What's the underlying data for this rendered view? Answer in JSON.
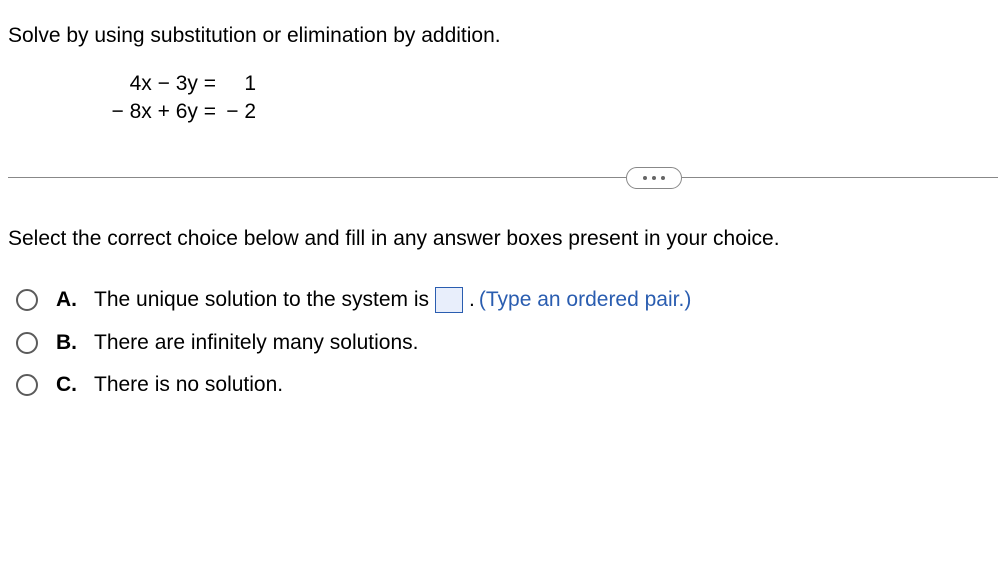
{
  "question": "Solve by using substitution or elimination by addition.",
  "equations": {
    "eq1_left": "4x − 3y =",
    "eq1_right": "1",
    "eq2_left": "− 8x + 6y =",
    "eq2_right": "− 2"
  },
  "instruction": "Select the correct choice below and fill in any answer boxes present in your choice.",
  "options": {
    "a": {
      "letter": "A.",
      "text_before": "The unique solution to the system is",
      "period": ".",
      "hint": "(Type an ordered pair.)"
    },
    "b": {
      "letter": "B.",
      "text": "There are infinitely many solutions."
    },
    "c": {
      "letter": "C.",
      "text": "There is no solution."
    }
  }
}
